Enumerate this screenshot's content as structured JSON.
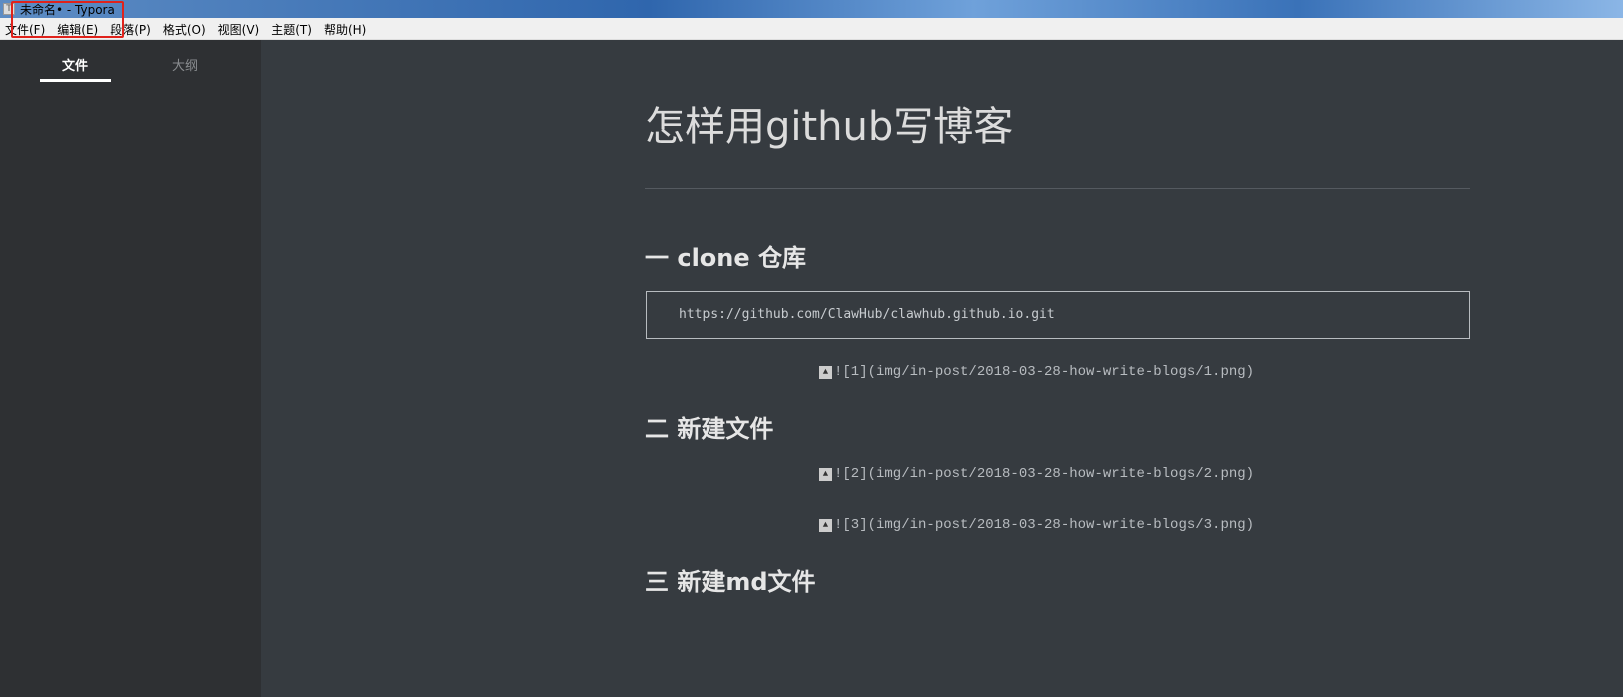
{
  "window": {
    "title": "未命名• - Typora",
    "app_icon": "T"
  },
  "menu": [
    "文件(F)",
    "编辑(E)",
    "段落(P)",
    "格式(O)",
    "视图(V)",
    "主题(T)",
    "帮助(H)"
  ],
  "sidebar": {
    "tabs": [
      {
        "label": "文件",
        "active": true
      },
      {
        "label": "大纲",
        "active": false
      }
    ]
  },
  "doc": {
    "title": "怎样用github写博客",
    "h2_1": "一 clone 仓库",
    "code": "https://github.com/ClawHub/clawhub.github.io.git",
    "img1": "![1](img/in-post/2018-03-28-how-write-blogs/1.png)",
    "h2_2": "二 新建文件",
    "img2": "![2](img/in-post/2018-03-28-how-write-blogs/2.png)",
    "img3": "![3](img/in-post/2018-03-28-how-write-blogs/3.png)",
    "h2_3": "三 新建md文件"
  },
  "colors": {
    "highlight_box": "#e0221b",
    "sidebar_bg": "#2e3033",
    "editor_bg": "#363b40"
  }
}
